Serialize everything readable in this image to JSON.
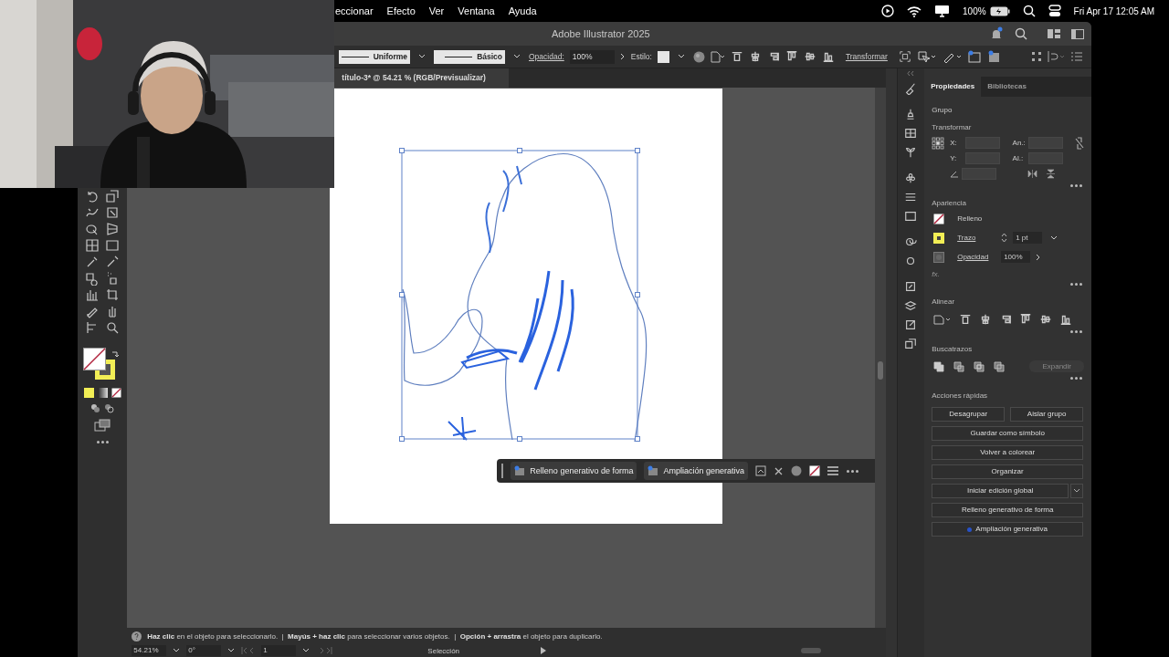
{
  "menu_bar": {
    "menus": [
      "eccionar",
      "Efecto",
      "Ver",
      "Ventana",
      "Ayuda"
    ],
    "battery": "100%",
    "clock": "Fri Apr 17  12:05 AM"
  },
  "window": {
    "title": "Adobe Illustrator 2025"
  },
  "control_bar": {
    "stroke_profile": "Uniforme",
    "brush": "Básico",
    "opacity_label": "Opacidad:",
    "opacity": "100%",
    "style_label": "Estilo:",
    "transform": "Transformar"
  },
  "document_tab": {
    "title": "título-3* @ 54.21 % (RGB/Previsualizar)"
  },
  "contextual_bar": {
    "buttons": [
      "Relleno generativo de forma",
      "Ampliación generativa"
    ]
  },
  "properties": {
    "tabs": [
      {
        "label": "Propiedades",
        "selected": true
      },
      {
        "label": "Bibliotecas",
        "selected": false
      }
    ],
    "object_type": "Grupo",
    "transform": {
      "title": "Transformar",
      "fields": [
        "X:",
        "An.:",
        "Y:",
        "Al.:"
      ]
    },
    "appearance": {
      "title": "Apariencia",
      "rows": [
        {
          "kind": "fill",
          "label": "Relleno"
        },
        {
          "kind": "stroke",
          "label": "Trazo",
          "value": "1 pt"
        },
        {
          "kind": "opacity",
          "label": "Opacidad",
          "value": "100%"
        }
      ],
      "fx": "fx."
    },
    "align": {
      "title": "Alinear"
    },
    "pathfinder": {
      "title": "Buscatrazos",
      "button": "Expandir",
      "button_disabled": true
    },
    "quick_actions": {
      "title": "Acciones rápidas",
      "buttons": [
        {
          "label": "Desagrupar",
          "kind": "half"
        },
        {
          "label": "Aislar grupo",
          "kind": "half"
        },
        {
          "label": "Guardar como símbolo",
          "kind": "full"
        },
        {
          "label": "Volver a colorear",
          "kind": "full"
        },
        {
          "label": "Organizar",
          "kind": "full"
        },
        {
          "label": "Iniciar edición global",
          "kind": "dropdown"
        },
        {
          "label": "Relleno generativo de forma",
          "kind": "full"
        },
        {
          "label": "Ampliación generativa",
          "kind": "dot"
        }
      ]
    }
  },
  "status_bar": {
    "hint": "**Haz clic** en el objeto para seleccionarlo.  |  **Mayús + haz clic** para seleccionar varios objetos.  |  **Opción + arrastra** el objeto para duplicarlo.",
    "zoom": "54.21%",
    "rotation": "0°",
    "artboard": "1",
    "tool": "Selección"
  }
}
